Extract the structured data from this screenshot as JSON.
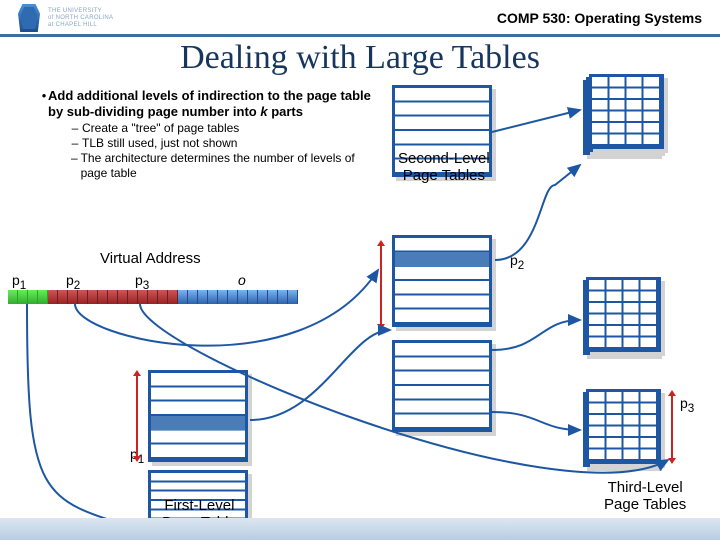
{
  "header": {
    "org_line1": "THE UNIVERSITY",
    "org_line2": "of NORTH CAROLINA",
    "org_line3": "at CHAPEL HILL",
    "course": "COMP 530: Operating Systems"
  },
  "title": "Dealing with Large Tables",
  "bullet": {
    "main_pre": "Add additional levels of indirection to the page table by sub-dividing page number into ",
    "main_k": "k",
    "main_post": " parts",
    "subs": [
      "Create a \"tree\" of page tables",
      "TLB still used, just not shown",
      "The architecture determines the number of levels of page table"
    ]
  },
  "labels": {
    "virtual_address": "Virtual Address",
    "p1": "p",
    "p1_sub": "1",
    "p2": "p",
    "p2_sub": "2",
    "p3": "p",
    "p3_sub": "3",
    "o": "o",
    "second_level": "Second-Level",
    "page_tables": "Page Tables",
    "first_level": "First-Level",
    "page_table": "Page Table",
    "third_level": "Third-Level",
    "third_page_tables": "Page Tables"
  }
}
